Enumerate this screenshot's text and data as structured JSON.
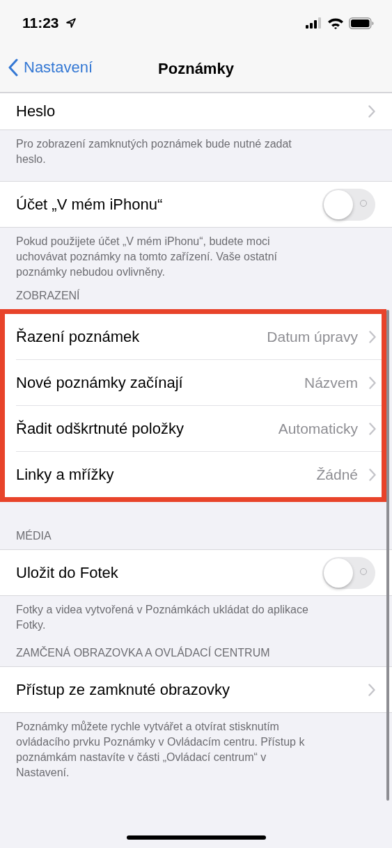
{
  "status_bar": {
    "time": "11:23"
  },
  "nav": {
    "back": "Nastavení",
    "title": "Poznámky"
  },
  "sections": [
    {
      "highlighted": false,
      "rows": [
        {
          "kind": "link",
          "label": "Heslo"
        }
      ],
      "footer": "Pro zobrazení zamknutých poznámek bude nutné zadat heslo."
    },
    {
      "highlighted": false,
      "rows": [
        {
          "kind": "toggle",
          "label": "Účet „V mém iPhonu“",
          "on": false
        }
      ],
      "footer": "Pokud použijete účet „V mém iPhonu“, budete moci uchovávat poznámky na tomto zařízení. Vaše ostatní poznámky nebudou ovlivněny."
    },
    {
      "header": "ZOBRAZENÍ",
      "highlighted": true,
      "rows": [
        {
          "kind": "link",
          "label": "Řazení poznámek",
          "value": "Datum úpravy"
        },
        {
          "kind": "link",
          "label": "Nové poznámky začínají",
          "value": "Názvem"
        },
        {
          "kind": "link",
          "label": "Řadit odškrtnuté položky",
          "value": "Automaticky"
        },
        {
          "kind": "link",
          "label": "Linky a mřížky",
          "value": "Žádné"
        }
      ]
    },
    {
      "header": "MÉDIA",
      "highlighted": false,
      "rows": [
        {
          "kind": "toggle",
          "label": "Uložit do Fotek",
          "on": false
        }
      ],
      "footer": "Fotky a videa vytvořená v Poznámkách ukládat do aplikace Fotky."
    },
    {
      "header": "ZAMČENÁ OBRAZOVKA A OVLÁDACÍ CENTRUM",
      "highlighted": false,
      "rows": [
        {
          "kind": "link",
          "label": "Přístup ze zamknuté obrazovky"
        }
      ],
      "footer": "Poznámky můžete rychle vytvářet a otvírat stisknutím ovládacího prvku Poznámky v Ovládacím centru. Přístup k poznámkám nastavíte v části „Ovládací centrum“ v Nastavení."
    }
  ]
}
